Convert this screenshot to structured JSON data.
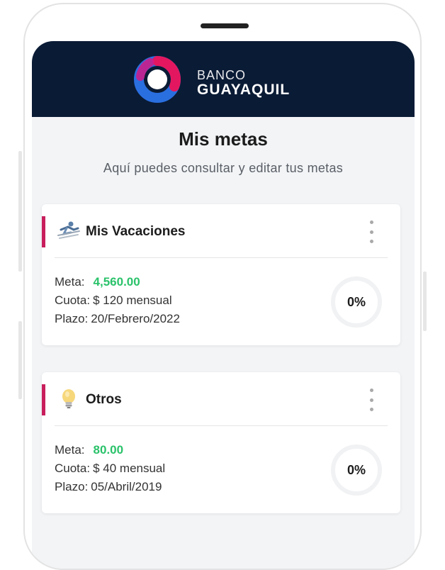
{
  "brand": {
    "line1": "BANCO",
    "line2": "GUAYAQUIL",
    "ring_colors": [
      "#e3175f",
      "#2a6fe0",
      "#0a1b35"
    ]
  },
  "page": {
    "title": "Mis metas",
    "subtitle": "Aquí puedes consultar y editar tus metas"
  },
  "labels": {
    "meta": "Meta:",
    "cuota": "Cuota:",
    "plazo": "Plazo:"
  },
  "goals": [
    {
      "icon": "skier-icon",
      "name": "Mis Vacaciones",
      "meta": "4,560.00",
      "cuota": "$ 120 mensual",
      "plazo": "20/Febrero/2022",
      "progress": "0%"
    },
    {
      "icon": "lightbulb-icon",
      "name": "Otros",
      "meta": "80.00",
      "cuota": "$ 40 mensual",
      "plazo": "05/Abril/2019",
      "progress": "0%"
    }
  ],
  "colors": {
    "header_bg": "#0a1b35",
    "accent_bar": "#c81e5c",
    "meta_value": "#2ac26a",
    "screen_bg": "#f2f4f6"
  }
}
